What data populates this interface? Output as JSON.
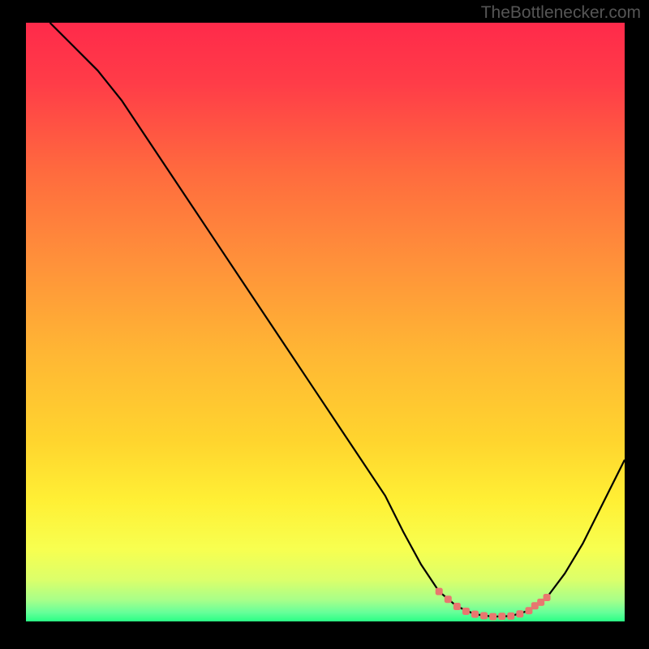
{
  "watermark": "TheBottlenecker.com",
  "chart_data": {
    "type": "line",
    "title": "",
    "xlabel": "",
    "ylabel": "",
    "xlim": [
      0,
      100
    ],
    "ylim": [
      0,
      100
    ],
    "series": [
      {
        "name": "bottleneck-curve",
        "x": [
          4,
          8,
          12,
          16,
          20,
          24,
          28,
          32,
          36,
          40,
          44,
          48,
          52,
          56,
          60,
          63,
          66,
          69,
          72,
          75,
          78,
          81,
          84,
          87,
          90,
          93,
          96,
          100
        ],
        "y": [
          100,
          96,
          92,
          87,
          81,
          75,
          69,
          63,
          57,
          51,
          45,
          39,
          33,
          27,
          21,
          15,
          9.5,
          5,
          2.5,
          1.2,
          0.8,
          0.9,
          1.8,
          4,
          8,
          13,
          19,
          27
        ]
      }
    ],
    "markers": {
      "name": "optimal-range",
      "x": [
        69,
        70.5,
        72,
        73.5,
        75,
        76.5,
        78,
        79.5,
        81,
        82.5,
        84,
        85,
        86,
        87
      ],
      "y": [
        5,
        3.7,
        2.5,
        1.7,
        1.2,
        0.95,
        0.8,
        0.85,
        0.9,
        1.25,
        1.8,
        2.6,
        3.2,
        4
      ]
    },
    "background_gradient": {
      "type": "vertical",
      "stops": [
        {
          "pos": 0.0,
          "color": "#ff2a4a"
        },
        {
          "pos": 0.1,
          "color": "#ff3c48"
        },
        {
          "pos": 0.25,
          "color": "#ff6b3e"
        },
        {
          "pos": 0.4,
          "color": "#ff913a"
        },
        {
          "pos": 0.55,
          "color": "#ffb634"
        },
        {
          "pos": 0.7,
          "color": "#ffd52e"
        },
        {
          "pos": 0.8,
          "color": "#fff035"
        },
        {
          "pos": 0.88,
          "color": "#f7ff50"
        },
        {
          "pos": 0.93,
          "color": "#dcff6a"
        },
        {
          "pos": 0.965,
          "color": "#a6ff8a"
        },
        {
          "pos": 0.985,
          "color": "#66ff99"
        },
        {
          "pos": 1.0,
          "color": "#2aff85"
        }
      ]
    },
    "marker_color": "#e8776f",
    "curve_color": "#000000"
  }
}
